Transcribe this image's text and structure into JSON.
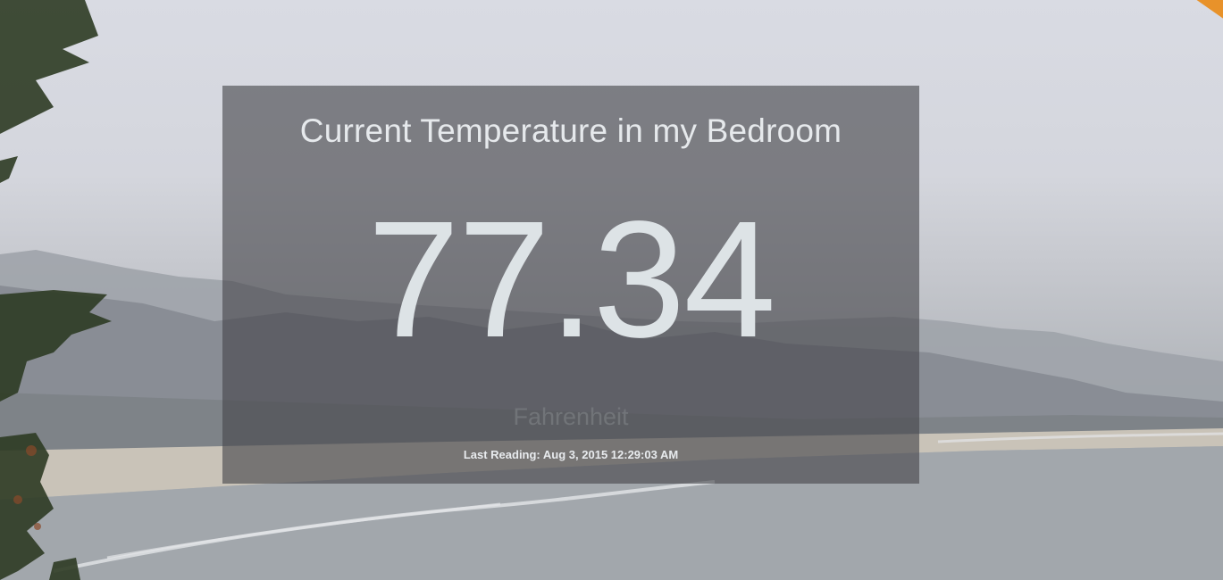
{
  "panel": {
    "title": "Current Temperature in my Bedroom",
    "temperature": "77.34",
    "unit": "Fahrenheit",
    "last_reading_label": "Last Reading:",
    "last_reading_time": "Aug 3, 2015 12:29:03 AM"
  },
  "background": {
    "scene": "coastal-landscape",
    "sky_color": "#d9dbe3",
    "hill_color": "#8a8f96",
    "sea_color": "#a6abb0",
    "accent_color": "#e8922a"
  }
}
